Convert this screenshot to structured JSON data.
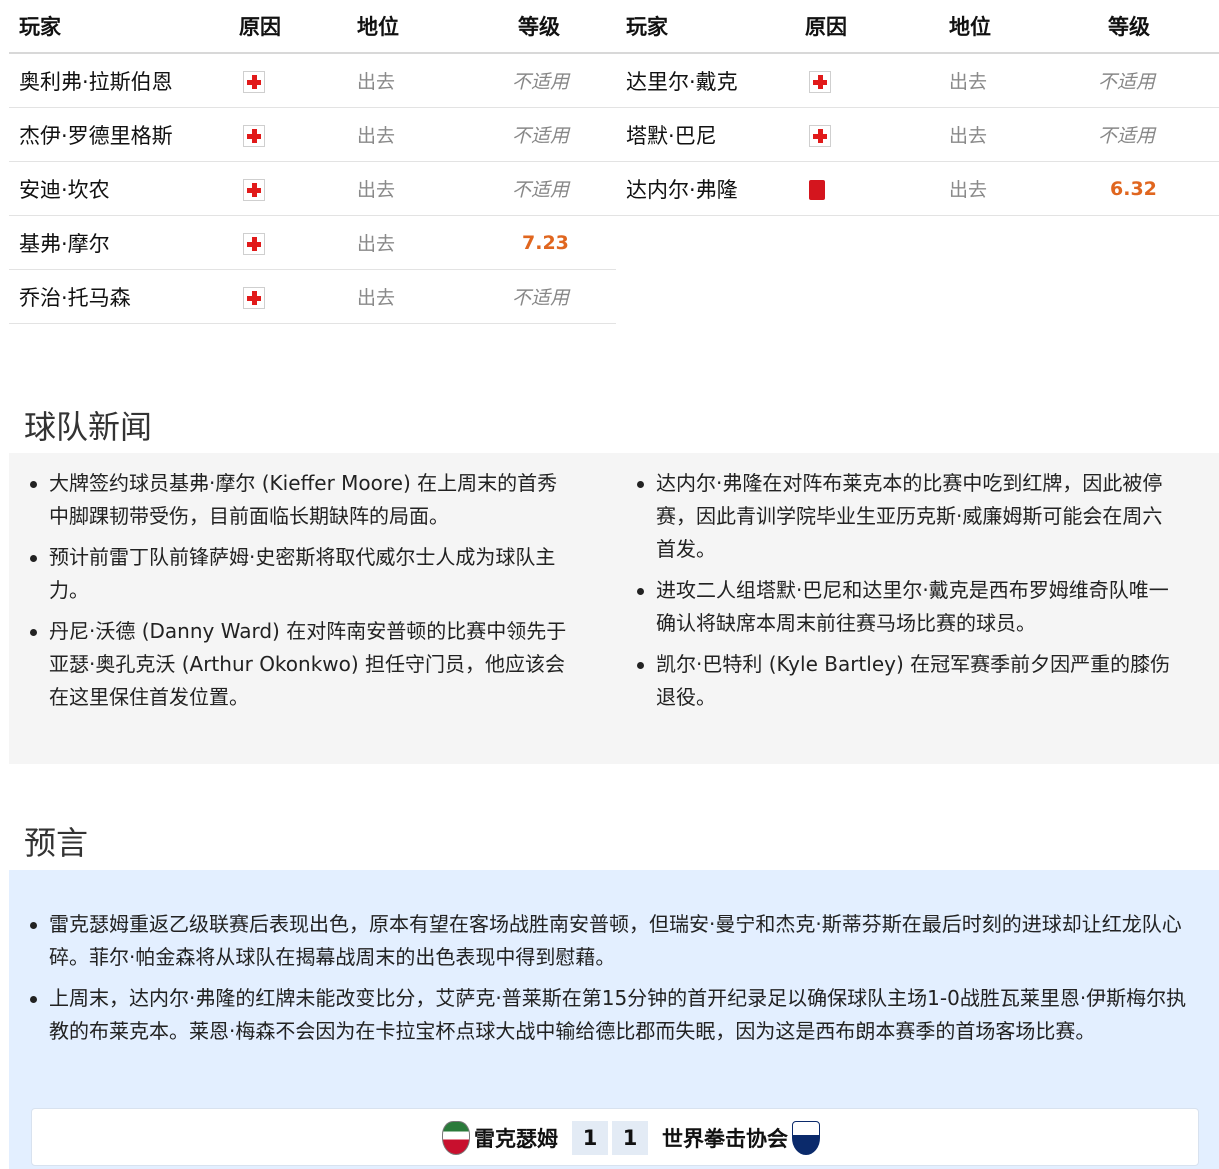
{
  "injuries": {
    "headers": {
      "player": "玩家",
      "reason": "原因",
      "status": "地位",
      "rating": "等级"
    },
    "left": [
      {
        "name": "奥利弗·拉斯伯恩",
        "reason_icon": "red-cross-icon",
        "status": "出去",
        "rating": "不适用",
        "rating_is_number": false
      },
      {
        "name": "杰伊·罗德里格斯",
        "reason_icon": "red-cross-icon",
        "status": "出去",
        "rating": "不适用",
        "rating_is_number": false
      },
      {
        "name": "安迪·坎农",
        "reason_icon": "red-cross-icon",
        "status": "出去",
        "rating": "不适用",
        "rating_is_number": false
      },
      {
        "name": "基弗·摩尔",
        "reason_icon": "red-cross-icon",
        "status": "出去",
        "rating": "7.23",
        "rating_is_number": true
      },
      {
        "name": "乔治·托马森",
        "reason_icon": "red-cross-icon",
        "status": "出去",
        "rating": "不适用",
        "rating_is_number": false
      }
    ],
    "right": [
      {
        "name": "达里尔·戴克",
        "reason_icon": "red-cross-icon",
        "status": "出去",
        "rating": "不适用",
        "rating_is_number": false
      },
      {
        "name": "塔默·巴尼",
        "reason_icon": "red-cross-icon",
        "status": "出去",
        "rating": "不适用",
        "rating_is_number": false
      },
      {
        "name": "达内尔·弗隆",
        "reason_icon": "red-card-icon",
        "status": "出去",
        "rating": "6.32",
        "rating_is_number": true
      }
    ]
  },
  "team_news": {
    "title": "球队新闻",
    "left": [
      "大牌签约球员基弗·摩尔 (Kieffer Moore) 在上周末的首秀中脚踝韧带受伤，目前面临长期缺阵的局面。",
      "预计前雷丁队前锋萨姆·史密斯将取代威尔士人成为球队主力。",
      "丹尼·沃德 (Danny Ward) 在对阵南安普顿的比赛中领先于亚瑟·奥孔克沃 (Arthur Okonkwo) 担任守门员，他应该会在这里保住首发位置。"
    ],
    "right": [
      "达内尔·弗隆在对阵布莱克本的比赛中吃到红牌，因此被停赛，因此青训学院毕业生亚历克斯·威廉姆斯可能会在周六首发。",
      "进攻二人组塔默·巴尼和达里尔·戴克是西布罗姆维奇队唯一确认将缺席本周末前往赛马场比赛的球员。",
      "凯尔·巴特利 (Kyle Bartley) 在冠军赛季前夕因严重的膝伤退役。"
    ]
  },
  "prediction": {
    "title": "预言",
    "items": [
      "雷克瑟姆重返乙级联赛后表现出色，原本有望在客场战胜南安普顿，但瑞安·曼宁和杰克·斯蒂芬斯在最后时刻的进球却让红龙队心碎。菲尔·帕金森将从球队在揭幕战周末的出色表现中得到慰藉。",
      "上周末，达内尔·弗隆的红牌未能改变比分，艾萨克·普莱斯在第15分钟的首开纪录足以确保球队主场1-0战胜瓦莱里恩·伊斯梅尔执教的布莱克本。莱恩·梅森不会因为在卡拉宝杯点球大战中输给德比郡而失眠，因为这是西布朗本赛季的首场客场比赛。"
    ],
    "score": {
      "home_team": "雷克瑟姆",
      "home_score": "1",
      "away_score": "1",
      "away_team": "世界拳击协会"
    }
  },
  "colors": {
    "rating_number": "#e0661f",
    "red_cross": "#e11a1a",
    "news_bg": "#f5f5f5",
    "prediction_bg": "#e3efff"
  }
}
